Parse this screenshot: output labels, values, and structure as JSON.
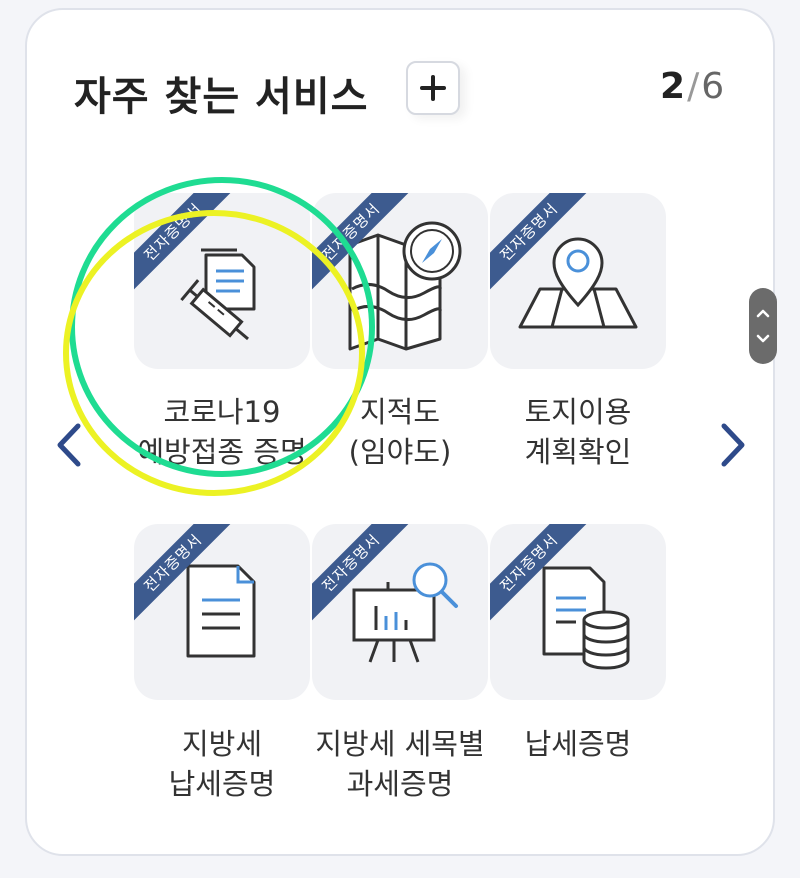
{
  "header": {
    "title": "자주 찾는 서비스",
    "add_icon": "plus-icon",
    "pager_current": "2",
    "pager_separator": "/",
    "pager_total": "6"
  },
  "badge_text": "전자증명서",
  "services": [
    {
      "icon": "vaccine-document-icon",
      "line1": "코로나19",
      "line2": "예방접종 증명"
    },
    {
      "icon": "map-compass-icon",
      "line1": "지적도",
      "line2": "(임야도)"
    },
    {
      "icon": "map-pin-icon",
      "line1": "토지이용",
      "line2": "계획확인"
    },
    {
      "icon": "document-icon",
      "line1": "지방세",
      "line2": "납세증명"
    },
    {
      "icon": "presentation-chart-icon",
      "line1": "지방세 세목별",
      "line2": "과세증명"
    },
    {
      "icon": "document-database-icon",
      "line1": "납세증명",
      "line2": ""
    }
  ],
  "navigation": {
    "prev_icon": "chevron-left-icon",
    "next_icon": "chevron-right-icon"
  },
  "colors": {
    "ribbon": "#3d5b8f",
    "accent_blue": "#4a90d9",
    "nav_arrow": "#2e4a8a",
    "circle_green": "#1fdc92",
    "circle_yellow": "#ecf224"
  }
}
